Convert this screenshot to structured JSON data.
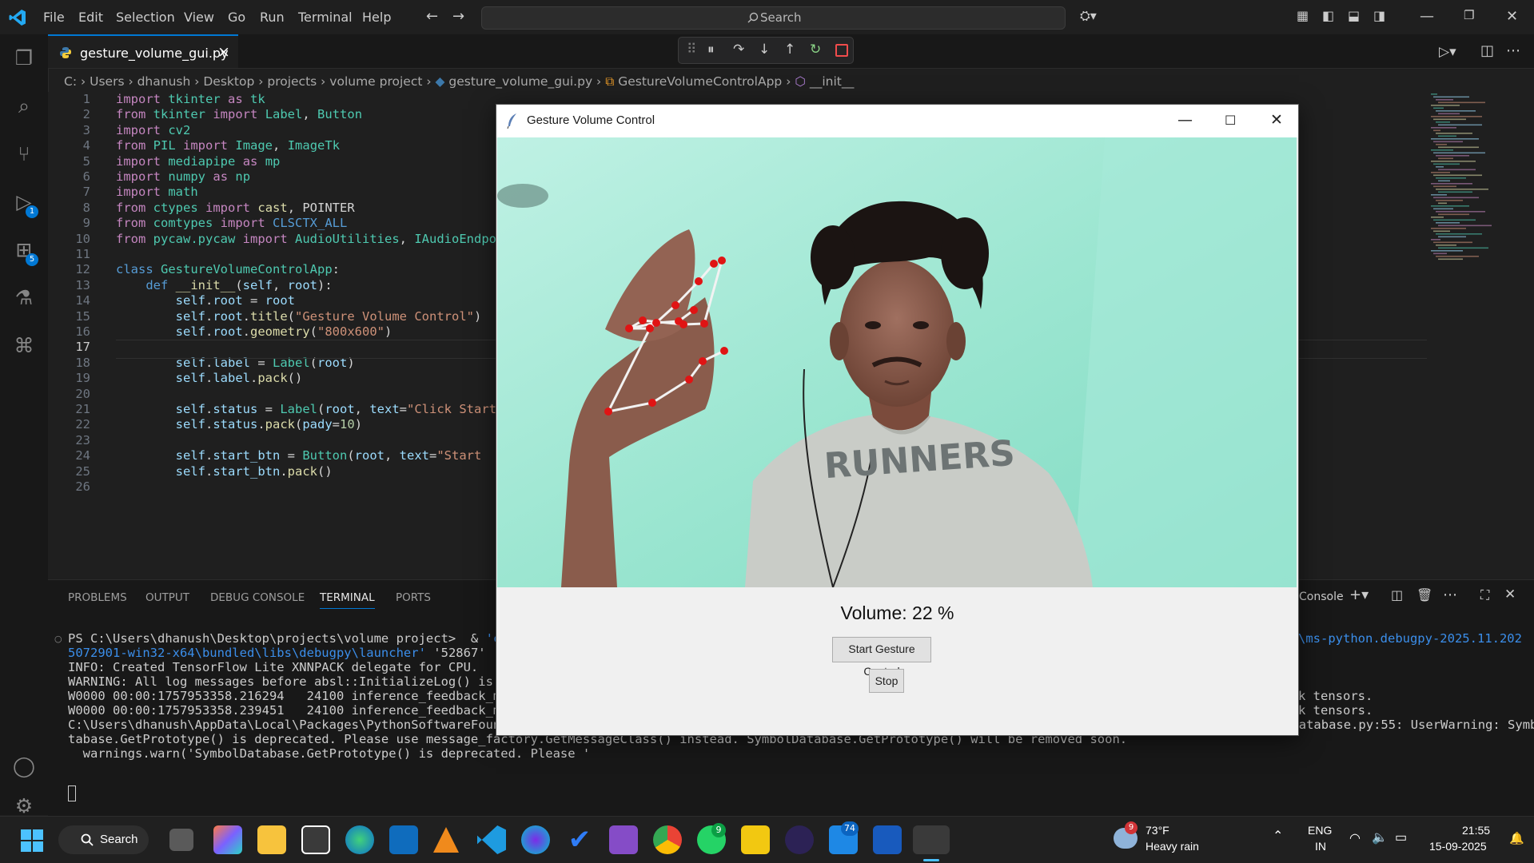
{
  "titlebar": {
    "menu": [
      "File",
      "Edit",
      "Selection",
      "View",
      "Go",
      "Run",
      "Terminal",
      "Help"
    ],
    "search_placeholder": "Search"
  },
  "tab": {
    "filename": "gesture_volume_gui.py",
    "close_icon": "×"
  },
  "breadcrumb": [
    "C:",
    "Users",
    "dhanush",
    "Desktop",
    "projects",
    "volume project",
    "gesture_volume_gui.py",
    "GestureVolumeControlApp",
    "__init__"
  ],
  "editor": {
    "lines": [
      {
        "n": "1",
        "html": "<span class='kw'>import</span> <span class='cls'>tkinter</span> <span class='kw'>as</span> <span class='cls'>tk</span>"
      },
      {
        "n": "2",
        "html": "<span class='kw'>from</span> <span class='cls'>tkinter</span> <span class='kw'>import</span> <span class='cls'>Label</span>, <span class='cls'>Button</span>"
      },
      {
        "n": "3",
        "html": "<span class='kw'>import</span> <span class='cls'>cv2</span>"
      },
      {
        "n": "4",
        "html": "<span class='kw'>from</span> <span class='cls'>PIL</span> <span class='kw'>import</span> <span class='cls'>Image</span>, <span class='cls'>ImageTk</span>"
      },
      {
        "n": "5",
        "html": "<span class='kw'>import</span> <span class='cls'>mediapipe</span> <span class='kw'>as</span> <span class='cls'>mp</span>"
      },
      {
        "n": "6",
        "html": "<span class='kw'>import</span> <span class='cls'>numpy</span> <span class='kw'>as</span> <span class='cls'>np</span>"
      },
      {
        "n": "7",
        "html": "<span class='kw'>import</span> <span class='cls'>math</span>"
      },
      {
        "n": "8",
        "html": "<span class='kw'>from</span> <span class='cls'>ctypes</span> <span class='kw'>import</span> <span class='fn'>cast</span>, POINTER"
      },
      {
        "n": "9",
        "html": "<span class='kw'>from</span> <span class='cls'>comtypes</span> <span class='kw'>import</span> <span class='k2'>CLSCTX_ALL</span>"
      },
      {
        "n": "10",
        "html": "<span class='kw'>from</span> <span class='cls'>pycaw.pycaw</span> <span class='kw'>import</span> <span class='cls'>AudioUtilities</span>, <span class='cls'>IAudioEndpointVolume</span>"
      },
      {
        "n": "11",
        "html": ""
      },
      {
        "n": "12",
        "html": "<span class='k2'>class</span> <span class='cls'>GestureVolumeControlApp</span>:"
      },
      {
        "n": "13",
        "html": "    <span class='k2'>def</span> <span class='fn'>__init__</span>(<span class='var'>self</span>, <span class='var'>root</span>):"
      },
      {
        "n": "14",
        "html": "        <span class='var'>self</span>.<span class='var'>root</span> = <span class='var'>root</span>"
      },
      {
        "n": "15",
        "html": "        <span class='var'>self</span>.<span class='var'>root</span>.<span class='fn'>title</span>(<span class='str'>\"Gesture Volume Control\"</span>)"
      },
      {
        "n": "16",
        "html": "        <span class='var'>self</span>.<span class='var'>root</span>.<span class='fn'>geometry</span>(<span class='str'>\"800x600\"</span>)"
      },
      {
        "n": "17",
        "html": ""
      },
      {
        "n": "18",
        "html": "        <span class='var'>self</span>.<span class='var'>label</span> = <span class='cls'>Label</span>(<span class='var'>root</span>)"
      },
      {
        "n": "19",
        "html": "        <span class='var'>self</span>.<span class='var'>label</span>.<span class='fn'>pack</span>()"
      },
      {
        "n": "20",
        "html": ""
      },
      {
        "n": "21",
        "html": "        <span class='var'>self</span>.<span class='var'>status</span> = <span class='cls'>Label</span>(<span class='var'>root</span>, <span class='var'>text</span>=<span class='str'>\"Click Start\"</span>"
      },
      {
        "n": "22",
        "html": "        <span class='var'>self</span>.<span class='var'>status</span>.<span class='fn'>pack</span>(<span class='var'>pady</span>=<span class='num'>10</span>)"
      },
      {
        "n": "23",
        "html": ""
      },
      {
        "n": "24",
        "html": "        <span class='var'>self</span>.<span class='var'>start_btn</span> = <span class='cls'>Button</span>(<span class='var'>root</span>, <span class='var'>text</span>=<span class='str'>\"Start</span>"
      },
      {
        "n": "25",
        "html": "        <span class='var'>self</span>.<span class='var'>start_btn</span>.<span class='fn'>pack</span>()"
      },
      {
        "n": "26",
        "html": ""
      }
    ]
  },
  "panel": {
    "tabs": [
      "PROBLEMS",
      "OUTPUT",
      "DEBUG CONSOLE",
      "TERMINAL",
      "PORTS"
    ],
    "active_tab": "TERMINAL",
    "terminal_name": "Console",
    "terminal_lines": [
      {
        "html": "PS C:\\Users\\dhanush\\Desktop\\projects\\volume project>  & <span style='color:#3b8eea'>'c:\\</span>"
      },
      {
        "html": "<span style='color:#3b8eea'>5072901-win32-x64\\bundled\\libs\\debugpy\\launcher'</span> <span style='color:#cccccc'>'52867'</span> <span style='color:#3b8eea'>'--</span>"
      },
      {
        "html": "INFO: Created TensorFlow Lite XNNPACK delegate for CPU."
      },
      {
        "html": "WARNING: All log messages before absl::InitializeLog() is ca"
      },
      {
        "html": "W0000 00:00:1757953358.216294   24100 inference_feedback_man"
      },
      {
        "html": "W0000 00:00:1757953358.239451   24100 inference_feedback_man"
      },
      {
        "html": "C:\\Users\\dhanush\\AppData\\Local\\Packages\\PythonSoftwareFoundation.Python.3.11_qbz5n2kfra8p0\\LocalCache\\local-packages\\Python311\\site-packages\\google\\protobuf\\symbol_database.py:55: UserWarning: SymbolDa"
      },
      {
        "html": "tabase.GetPrototype() is deprecated. Please use message_factory.GetMessageClass() instead. SymbolDatabase.GetPrototype() will be removed soon."
      },
      {
        "html": "  warnings.warn('SymbolDatabase.GetPrototype() is deprecated. Please '"
      }
    ],
    "right_fragments": {
      "line1": "\\ms-python.debugpy-2025.11.202",
      "tensors1": "k tensors.",
      "tensors2": "k tensors."
    }
  },
  "tk_window": {
    "title": "Gesture Volume Control",
    "volume_label": "Volume: 22 %",
    "volume_percent": 22,
    "start_button": "Start Gesture Control",
    "stop_button": "Stop",
    "shirt_text": "RUNNERS"
  },
  "taskbar": {
    "search": "Search",
    "weather_temp": "73°F",
    "weather_desc": "Heavy rain",
    "weather_badge": "9",
    "lang": "ENG",
    "region": "IN",
    "time": "21:55",
    "date": "15-09-2025",
    "whatsapp_badge": "9",
    "mail_badge": "74"
  },
  "activity_badges": {
    "debug": "1",
    "extensions": "5"
  },
  "colors": {
    "accent": "#0078d4",
    "editor_bg": "#1f1f1f",
    "landmark": "#e01414"
  }
}
